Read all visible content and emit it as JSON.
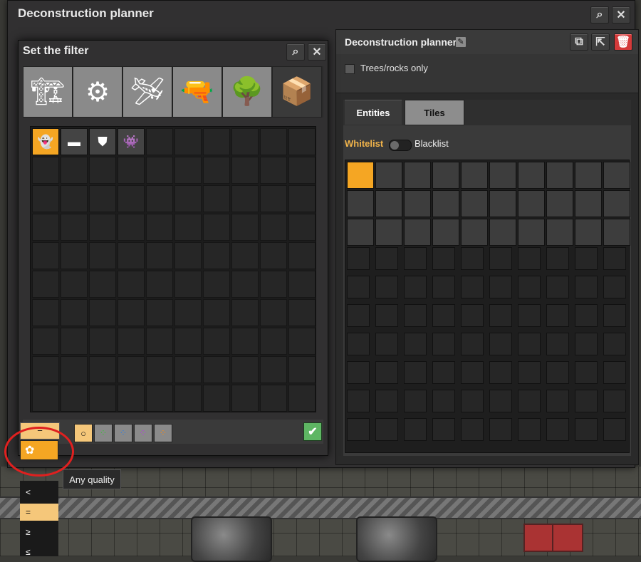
{
  "window": {
    "title": "Deconstruction planner",
    "search_icon": "search-icon",
    "close_icon": "close-icon"
  },
  "planner": {
    "title": "Deconstruction planner",
    "edit_icon": "edit-icon",
    "buttons": [
      "copy-icon",
      "export-icon",
      "trash-icon"
    ],
    "trees_rocks_label": "Trees/rocks only",
    "tabs": [
      {
        "label": "Entities",
        "active": true
      },
      {
        "label": "Tiles",
        "active": false
      }
    ],
    "whitelist_label": "Whitelist",
    "blacklist_label": "Blacklist"
  },
  "filter": {
    "title": "Set the filter",
    "categories": [
      {
        "name": "logistics-category",
        "glyph": "🏗"
      },
      {
        "name": "production-category",
        "glyph": "⚙"
      },
      {
        "name": "intermediate-category",
        "glyph": "🛩"
      },
      {
        "name": "combat-category",
        "glyph": "🔫"
      },
      {
        "name": "environment-category",
        "glyph": "🌳"
      },
      {
        "name": "unsorted-category",
        "glyph": "📦"
      }
    ],
    "items": [
      {
        "name": "ghost-item",
        "glyph": "👻"
      },
      {
        "name": "item-on-ground",
        "glyph": "▬"
      },
      {
        "name": "shield-item",
        "glyph": "⛊"
      },
      {
        "name": "tile-ghost-item",
        "glyph": "👾"
      }
    ],
    "qualities": [
      "○",
      "⁘",
      "⁘",
      "⁘",
      "⁘"
    ],
    "confirm_glyph": "✔"
  },
  "comparator": {
    "current": "=",
    "options": [
      "<",
      "=",
      "≥",
      "≤"
    ],
    "tooltip": "Any quality"
  }
}
